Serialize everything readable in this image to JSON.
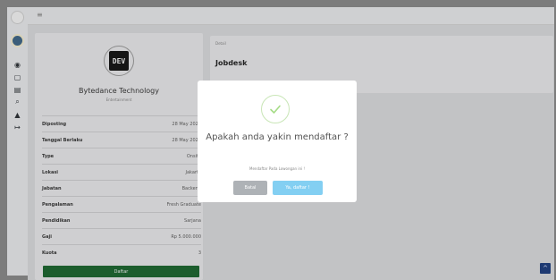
{
  "topbar": {
    "menu_icon": "hamburger-icon"
  },
  "sidebar": {
    "icons": [
      "dashboard-icon",
      "chat-icon",
      "document-icon",
      "search-icon",
      "lock-icon",
      "logout-icon"
    ]
  },
  "job": {
    "logo_text": "DEV",
    "company": "Bytedance Technology",
    "category": "Entertainment",
    "rows": [
      {
        "label": "Diposting",
        "value": "28 May 2022"
      },
      {
        "label": "Tanggal Berlaku",
        "value": "28 May 2022"
      },
      {
        "label": "Type",
        "value": "Onsite"
      },
      {
        "label": "Lokasi",
        "value": "Jakarta"
      },
      {
        "label": "Jabatan",
        "value": "Backend"
      },
      {
        "label": "Pengalaman",
        "value": "Fresh Graduate"
      },
      {
        "label": "Pendidikan",
        "value": "Sarjana"
      },
      {
        "label": "Gaji",
        "value": "Rp 5.000.000"
      },
      {
        "label": "Kuota",
        "value": "3"
      }
    ],
    "apply_label": "Daftar"
  },
  "detail": {
    "label": "Detail",
    "title": "Jobdesk"
  },
  "modal": {
    "title": "Apakah anda yakin mendaftar ?",
    "text": "Mendaftar Pada Lowongan ini !",
    "cancel_label": "Batal",
    "confirm_label": "Ya, daftar !"
  },
  "colors": {
    "success": "#a5dc86",
    "confirm": "#83cff2",
    "apply": "#1c5d2d"
  }
}
